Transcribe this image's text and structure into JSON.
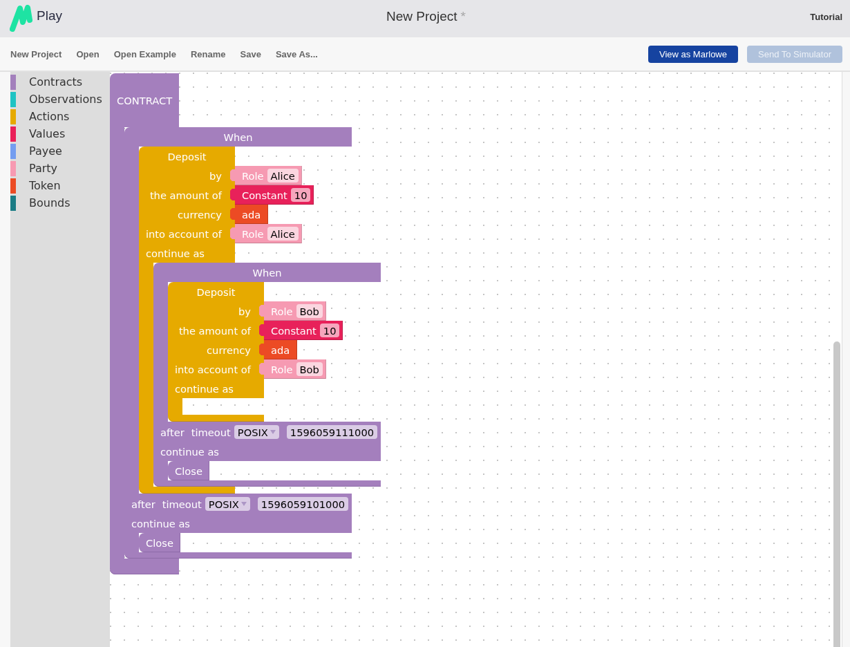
{
  "header": {
    "logo_text": "Play",
    "title": "New Project",
    "unsaved_mark": "*",
    "tutorial_link": "Tutorial"
  },
  "toolbar": {
    "menu": [
      "New Project",
      "Open",
      "Open Example",
      "Rename",
      "Save",
      "Save As..."
    ],
    "buttons": [
      {
        "label": "View as Marlowe",
        "disabled": false
      },
      {
        "label": "Send To Simulator",
        "disabled": true
      }
    ]
  },
  "toolbox": {
    "categories": [
      {
        "label": "Contracts",
        "color": "#a380bc"
      },
      {
        "label": "Observations",
        "color": "#1fc3c3"
      },
      {
        "label": "Actions",
        "color": "#e6aa00"
      },
      {
        "label": "Values",
        "color": "#ea2059"
      },
      {
        "label": "Payee",
        "color": "#749df0"
      },
      {
        "label": "Party",
        "color": "#f79ab2"
      },
      {
        "label": "Token",
        "color": "#ec4b24"
      },
      {
        "label": "Bounds",
        "color": "#1b7c85"
      }
    ]
  },
  "workspace": {
    "blocks": [
      {
        "kind": "contract",
        "label": "CONTRACT",
        "body": [
          {
            "kind": "when",
            "label": "When",
            "cases": [
              {
                "kind": "deposit",
                "label": "Deposit",
                "inputs": [
                  {
                    "label": "by",
                    "value": {
                      "kind": "role",
                      "label": "Role",
                      "field": "Alice"
                    }
                  },
                  {
                    "label": "the amount of",
                    "value": {
                      "kind": "constant",
                      "label": "Constant",
                      "field": "10"
                    }
                  },
                  {
                    "label": "currency",
                    "value": {
                      "kind": "token",
                      "label": "ada"
                    }
                  },
                  {
                    "label": "into account of",
                    "value": {
                      "kind": "role",
                      "label": "Role",
                      "field": "Alice"
                    }
                  }
                ],
                "continue_label": "continue as",
                "continuation": [
                  {
                    "kind": "when",
                    "label": "When",
                    "cases": [
                      {
                        "kind": "deposit",
                        "label": "Deposit",
                        "inputs": [
                          {
                            "label": "by",
                            "value": {
                              "kind": "role",
                              "label": "Role",
                              "field": "Bob"
                            }
                          },
                          {
                            "label": "the amount of",
                            "value": {
                              "kind": "constant",
                              "label": "Constant",
                              "field": "10"
                            }
                          },
                          {
                            "label": "currency",
                            "value": {
                              "kind": "token",
                              "label": "ada"
                            }
                          },
                          {
                            "label": "into account of",
                            "value": {
                              "kind": "role",
                              "label": "Role",
                              "field": "Bob"
                            }
                          }
                        ],
                        "continue_label": "continue as"
                      }
                    ],
                    "after_label": "after",
                    "timeout_label": "timeout",
                    "timeout_type": "POSIX",
                    "timeout": "1596059111000",
                    "continue_label": "continue as",
                    "continuation": [
                      {
                        "kind": "close",
                        "label": "Close"
                      }
                    ]
                  }
                ]
              }
            ],
            "after_label": "after",
            "timeout_label": "timeout",
            "timeout_type": "POSIX",
            "timeout": "1596059101000",
            "continue_label": "continue as",
            "continuation": [
              {
                "kind": "close",
                "label": "Close"
              }
            ]
          }
        ]
      }
    ]
  }
}
